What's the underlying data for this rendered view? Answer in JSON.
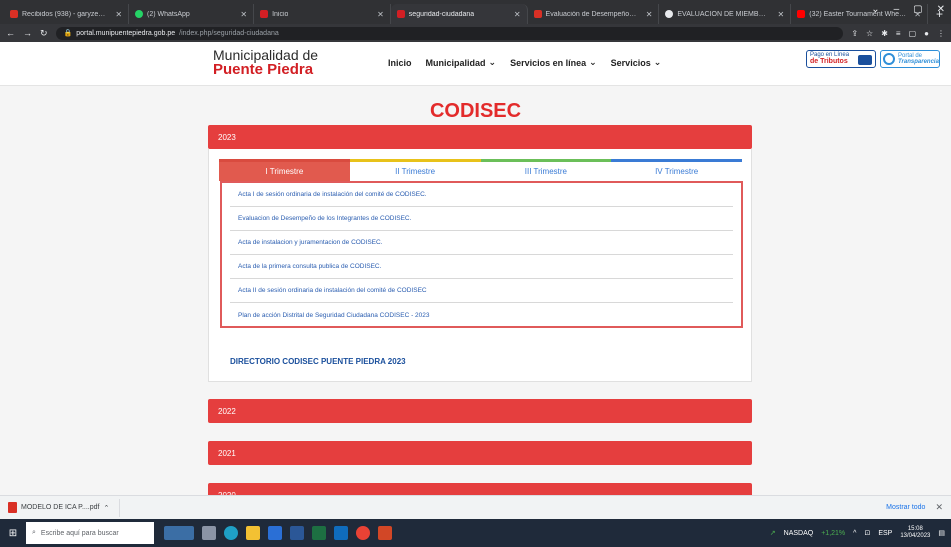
{
  "browser": {
    "tabs": [
      {
        "title": "Recibidos (938) - garyzegarrau...",
        "color": "#d93025",
        "active": false
      },
      {
        "title": "(2) WhatsApp",
        "color": "#25d366",
        "active": false
      },
      {
        "title": "Inicio",
        "color": "#d21f24",
        "active": false
      },
      {
        "title": "seguridad-ciudadana",
        "color": "#d21f24",
        "active": true
      },
      {
        "title": "Evaluación de Desempeño CO...",
        "color": "#d93025",
        "active": false
      },
      {
        "title": "EVALUACION DE MIEMBROS T...",
        "color": "#e8eaed",
        "active": false
      },
      {
        "title": "(32) Easter Tournament Wheeli...",
        "color": "#ff0000",
        "active": false
      }
    ],
    "new_tab": "+",
    "window_controls": {
      "minimize": "⌄",
      "restore": "–",
      "maximize": "▢",
      "close": "✕"
    },
    "url_host": "portal.munipuentepiedra.gob.pe",
    "url_path": "/index.php/seguridad-ciudadana"
  },
  "site": {
    "logo_line1": "Municipalidad de",
    "logo_line2": "Puente Piedra",
    "nav": [
      "Inicio",
      "Municipalidad",
      "Servicios en línea",
      "Servicios"
    ],
    "pay_badge_line1": "Pago en Línea",
    "pay_badge_line2": "de Tributos",
    "transparency_line1": "Portal de",
    "transparency_line2": "Transparencia"
  },
  "page": {
    "title": "CODISEC",
    "years": [
      "2023",
      "2022",
      "2021",
      "2020"
    ],
    "quarters": [
      "I Trimestre",
      "II Trimestre",
      "III Trimestre",
      "IV Trimestre"
    ],
    "documents": [
      "Acta I de sesión ordinaria de instalación del comité de CODISEC.",
      "Evaluacion de Desempeño de los Integrantes de CODISEC.",
      "Acta de instalacion y juramentacion de CODISEC.",
      "Acta de la primera consulta publica de CODISEC.",
      "Acta II de sesión ordinaria de instalación del comité de CODISEC",
      "Plan de acción Distrital de Seguridad Ciudadana CODISEC - 2023"
    ],
    "directory_link": "DIRECTORIO CODISEC PUENTE PIEDRA  2023"
  },
  "download_bar": {
    "file_name": "MODELO DE ICA P....pdf",
    "show_all": "Mostrar todo",
    "close": "✕"
  },
  "taskbar": {
    "search_placeholder": "Escribe aquí para buscar",
    "nasdaq_label": "NASDAQ",
    "nasdaq_change": "+1,21%",
    "language": "ESP",
    "time": "15:08",
    "date": "13/04/2023"
  }
}
